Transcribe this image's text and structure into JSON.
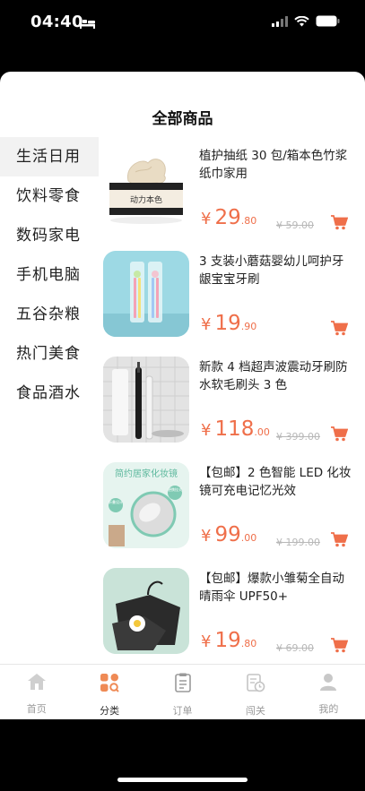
{
  "status": {
    "time": "04:40"
  },
  "page": {
    "title": "全部商品"
  },
  "categories": [
    {
      "label": "生活日用",
      "active": true
    },
    {
      "label": "饮料零食"
    },
    {
      "label": "数码家电"
    },
    {
      "label": "手机电脑"
    },
    {
      "label": "五谷杂粮"
    },
    {
      "label": "热门美食"
    },
    {
      "label": "食品酒水"
    }
  ],
  "products": [
    {
      "name": "植护抽纸 30 包/箱本色竹浆纸巾家用",
      "yen": "¥",
      "price_int": "29",
      "price_dec": ".80",
      "orig": "¥ 59.00"
    },
    {
      "name": "3 支装小蘑菇婴幼儿呵护牙龈宝宝牙刷",
      "yen": "¥",
      "price_int": "19",
      "price_dec": ".90",
      "orig": ""
    },
    {
      "name": "新款 4 档超声波震动牙刷防水软毛刷头 3 色",
      "yen": "¥",
      "price_int": "118",
      "price_dec": ".00",
      "orig": "¥ 399.00"
    },
    {
      "name": "【包邮】2 色智能 LED 化妆镜可充电记忆光效",
      "yen": "¥",
      "price_int": "99",
      "price_dec": ".00",
      "orig": "¥ 199.00"
    },
    {
      "name": "【包邮】爆款小雏菊全自动晴雨伞 UPF50+",
      "yen": "¥",
      "price_int": "19",
      "price_dec": ".80",
      "orig": "¥ 69.00"
    }
  ],
  "image_text": {
    "tissue_brand": "动力本色",
    "mirror_banner": "简约居家化妆镜",
    "mirror_badge1": "便携挂式",
    "mirror_badge2": "折叠设计"
  },
  "tabs": [
    {
      "label": "首页",
      "icon": "home-icon"
    },
    {
      "label": "分类",
      "icon": "category-icon",
      "active": true
    },
    {
      "label": "订单",
      "icon": "order-icon"
    },
    {
      "label": "闯关",
      "icon": "level-icon"
    },
    {
      "label": "我的",
      "icon": "profile-icon"
    }
  ],
  "colors": {
    "accent": "#ef6f4a",
    "sidebar_active": "#f2f2f2",
    "tab_inactive": "#9a9a9a"
  }
}
